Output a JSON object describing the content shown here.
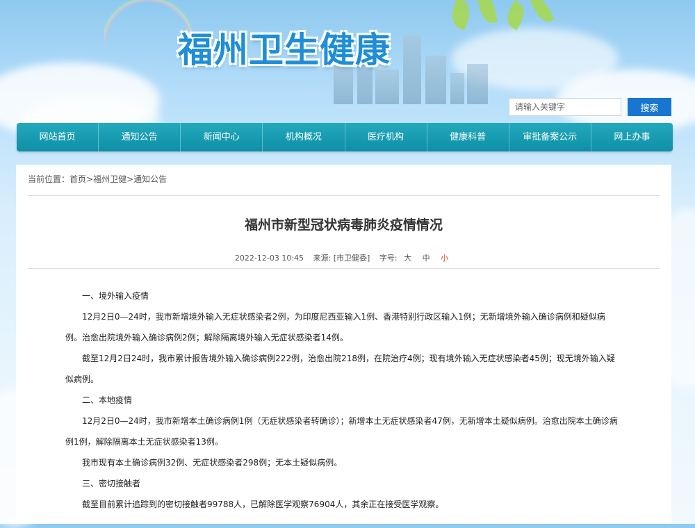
{
  "site": {
    "title": "福州卫生健康"
  },
  "search": {
    "placeholder": "请输入关键字",
    "button_label": "搜索"
  },
  "nav": {
    "items": [
      {
        "label": "网站首页"
      },
      {
        "label": "通知公告"
      },
      {
        "label": "新闻中心"
      },
      {
        "label": "机构概况"
      },
      {
        "label": "医疗机构"
      },
      {
        "label": "健康科普"
      },
      {
        "label": "审批备案公示"
      },
      {
        "label": "网上办事"
      }
    ]
  },
  "breadcrumb": {
    "prefix": "当前位置：",
    "items": [
      "首页",
      "福州卫健",
      "通知公告"
    ],
    "separator": ">"
  },
  "article": {
    "title": "福州市新型冠状病毒肺炎疫情情况",
    "date": "2022-12-03 10:45",
    "source": "来源: [市卫健委]",
    "font_size_label": "字号:",
    "font_sizes": [
      "大",
      "中",
      "小"
    ],
    "active_font_size": "小",
    "paragraphs": [
      "一、境外输入疫情",
      "12月2日0—24时，我市新增境外输入无症状感染者2例，为印度尼西亚输入1例、香港特别行政区输入1例；无新增境外输入确诊病例和疑似病例。治愈出院境外输入确诊病例2例；解除隔离境外输入无症状感染者14例。",
      "截至12月2日24时，我市累计报告境外输入确诊病例222例，治愈出院218例，在院治疗4例；现有境外输入无症状感染者45例；现无境外输入疑似病例。",
      "二、本地疫情",
      "12月2日0—24时，我市新增本土确诊病例1例（无症状感染者转确诊）；新增本土无症状感染者47例，无新增本土疑似病例。治愈出院本土确诊病例1例，解除隔离本土无症状感染者13例。",
      "我市现有本土确诊病例32例、无症状感染者298例；无本土疑似病例。",
      "三、密切接触者",
      "截至目前累计追踪到的密切接触者99788人，已解除医学观察76904人，其余正在接受医学观察。"
    ]
  },
  "colors": {
    "nav_bg": "#1a9db3",
    "search_button": "#1876d2",
    "title_blue": "#1f8ed6",
    "active_font_size": "#e04a1c"
  }
}
